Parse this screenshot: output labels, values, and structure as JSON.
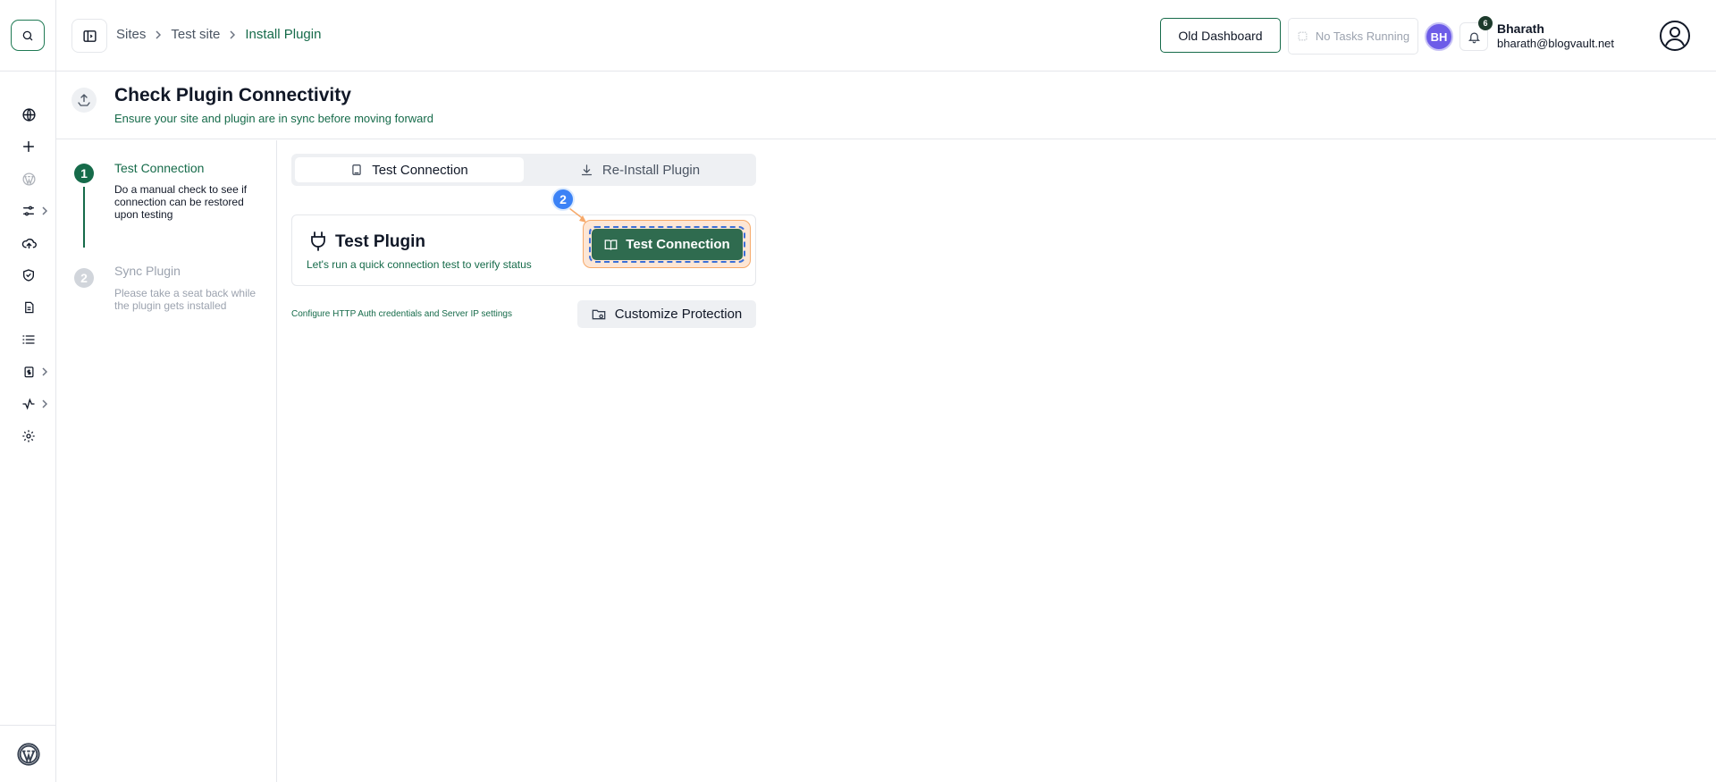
{
  "header": {
    "breadcrumb": [
      "Sites",
      "Test site",
      "Install Plugin"
    ],
    "old_dashboard_label": "Old Dashboard",
    "tasks_label": "No Tasks Running",
    "avatar_initials": "BH",
    "notification_count": "6",
    "user_name": "Bharath",
    "user_email": "bharath@blogvault.net"
  },
  "page": {
    "title": "Check Plugin Connectivity",
    "subtitle": "Ensure your site and plugin are in sync before moving forward"
  },
  "steps": [
    {
      "number": "1",
      "title": "Test Connection",
      "description": "Do a manual check to see if connection can be restored upon testing",
      "active": true
    },
    {
      "number": "2",
      "title": "Sync Plugin",
      "description": "Please take a seat back while the plugin gets installed",
      "active": false
    }
  ],
  "tabs": [
    {
      "label": "Test Connection",
      "icon": "clipboard-icon",
      "active": true
    },
    {
      "label": "Re-Install Plugin",
      "icon": "download-icon",
      "active": false
    }
  ],
  "card": {
    "title": "Test Plugin",
    "description": "Let's run a quick connection test to verify status",
    "button_label": "Test Connection"
  },
  "marker_label": "2",
  "config_link": "Configure HTTP Auth credentials and Server IP settings",
  "customize_button": "Customize Protection",
  "colors": {
    "primary": "#166b4a",
    "button": "#2f6b4f",
    "highlight_fill": "#fde6d5",
    "highlight_border": "#f6a96a",
    "marker": "#3b82f6",
    "avatar": "#6d5ce8"
  },
  "rail_icons": [
    "search-icon",
    "globe-icon",
    "plus-icon",
    "wordpress-icon",
    "sliders-icon",
    "cloud-upload-icon",
    "shield-check-icon",
    "file-icon",
    "list-icon",
    "clipboard-dollar-icon",
    "activity-icon",
    "gear-icon",
    "wordpress-logo"
  ]
}
